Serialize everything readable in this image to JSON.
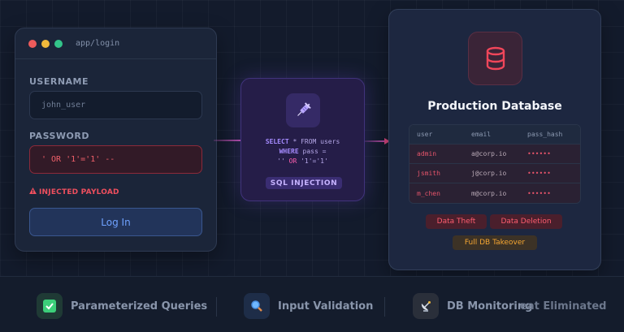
{
  "login": {
    "window_title": "app/login",
    "username_label": "USERNAME",
    "username_value": "john_user",
    "password_label": "PASSWORD",
    "password_value": "' OR '1'='1' --",
    "warning_text": "INJECTED PAYLOAD",
    "button_label": "Log In"
  },
  "injection": {
    "icon": "syringe-icon",
    "sql": {
      "l1_kw1": "SELECT",
      "l1_tx": " * FROM users",
      "l2_kw": "WHERE",
      "l2_tx": " pass =",
      "l3_a": "'' ",
      "l3_kw": "OR",
      "l3_b": " '1'='1'"
    },
    "badge": "SQL INJECTION"
  },
  "database": {
    "icon": "database-icon",
    "title": "Production Database",
    "columns": [
      "user",
      "email",
      "pass_hash"
    ],
    "rows": [
      {
        "user": "admin",
        "email": "a@corp.io",
        "pass_hash": "••••••"
      },
      {
        "user": "jsmith",
        "email": "j@corp.io",
        "pass_hash": "••••••"
      },
      {
        "user": "m_chen",
        "email": "m@corp.io",
        "pass_hash": "••••••"
      }
    ],
    "tags": [
      "Data Theft",
      "Data Deletion",
      "Full DB Takeover"
    ]
  },
  "bottom": {
    "features": [
      {
        "label": "Parameterized Queries",
        "icon": "check-icon"
      },
      {
        "label": "Input Validation",
        "icon": "magnifier-icon"
      },
      {
        "label": "DB Monitoring",
        "icon": "satellite-dish-icon"
      }
    ],
    "overlap_text": "eat Eliminated"
  },
  "colors": {
    "accent_red": "#ef4f5e",
    "accent_purple": "#a58bff",
    "accent_blue": "#6fa2ff",
    "accent_orange": "#f5a632"
  }
}
